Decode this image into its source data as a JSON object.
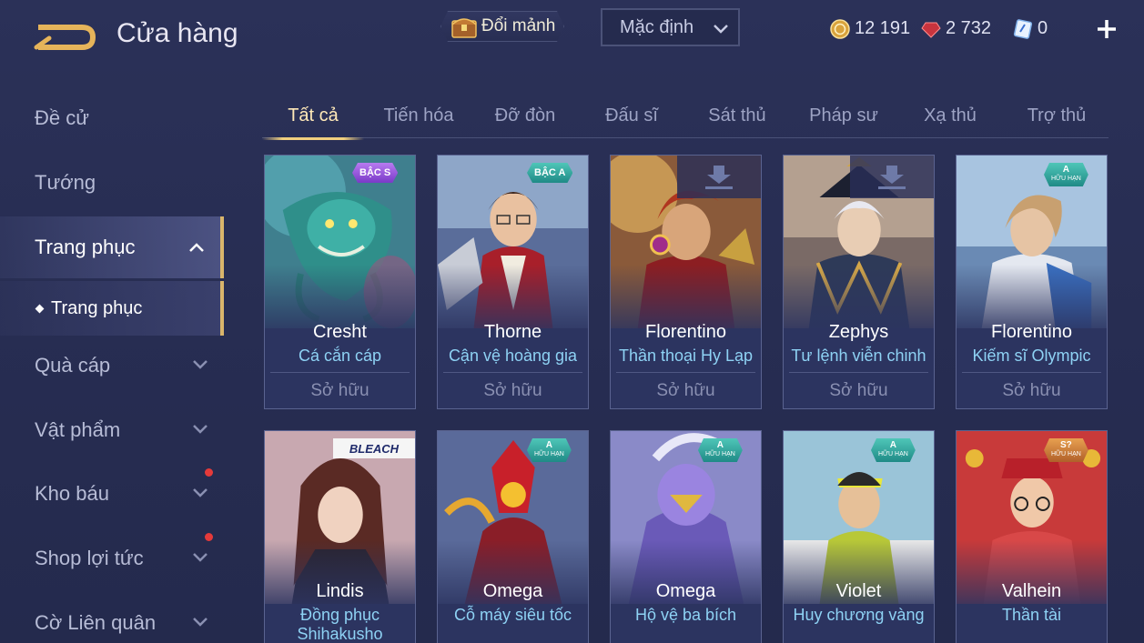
{
  "header": {
    "title": "Cửa hàng",
    "exchange_label": "Đổi mảnh",
    "sort_value": "Mặc định",
    "currencies": {
      "gold": "12 191",
      "ruby": "2 732",
      "voucher": "0"
    }
  },
  "sidebar": {
    "items": [
      {
        "label": "Đề cử"
      },
      {
        "label": "Tướng"
      },
      {
        "label": "Trang phục"
      },
      {
        "label": "Trang phục"
      },
      {
        "label": "Quà cáp"
      },
      {
        "label": "Vật phẩm"
      },
      {
        "label": "Kho báu"
      },
      {
        "label": "Shop lợi tức"
      },
      {
        "label": "Cờ Liên quân"
      }
    ]
  },
  "tabs": [
    "Tất cả",
    "Tiến hóa",
    "Đỡ đòn",
    "Đấu sĩ",
    "Sát thủ",
    "Pháp sư",
    "Xạ thủ",
    "Trợ thủ"
  ],
  "cards": [
    {
      "hero": "Cresht",
      "skin": "Cá cắn cáp",
      "status": "Sở hữu",
      "badge": "BẬC S"
    },
    {
      "hero": "Thorne",
      "skin": "Cận vệ hoàng gia",
      "status": "Sở hữu",
      "badge": "BẬC A"
    },
    {
      "hero": "Florentino",
      "skin": "Thần thoại Hy Lạp",
      "status": "Sở hữu"
    },
    {
      "hero": "Zephys",
      "skin": "Tư lệnh viễn chinh",
      "status": "Sở hữu"
    },
    {
      "hero": "Florentino",
      "skin": "Kiếm sĩ Olympic",
      "status": "Sở hữu",
      "badge": "A",
      "badge_sub": "HỮU HẠN"
    },
    {
      "hero": "Lindis",
      "skin_line1": "Đồng phục",
      "skin_line2": "Shihakusho",
      "logo": "BLEACH"
    },
    {
      "hero": "Omega",
      "skin": "Cỗ máy siêu tốc",
      "badge": "A",
      "badge_sub": "HỮU HẠN"
    },
    {
      "hero": "Omega",
      "skin": "Hộ vệ ba bích",
      "badge": "A",
      "badge_sub": "HỮU HẠN"
    },
    {
      "hero": "Violet",
      "skin": "Huy chương vàng",
      "badge": "A",
      "badge_sub": "HỮU HẠN"
    },
    {
      "hero": "Valhein",
      "skin": "Thần tài",
      "badge": "S?",
      "badge_sub": "HỮU HẠN"
    }
  ],
  "colors": {
    "accent_gold": "#d9b56b",
    "skin_name": "#8ed2f4",
    "notification": "#e53a3a"
  },
  "icons": [
    "back-arrow-icon",
    "chest-icon",
    "chevron-down-icon",
    "gold-coin-icon",
    "ruby-gem-icon",
    "voucher-icon",
    "plus-icon",
    "download-icon",
    "chevron-up-icon"
  ]
}
